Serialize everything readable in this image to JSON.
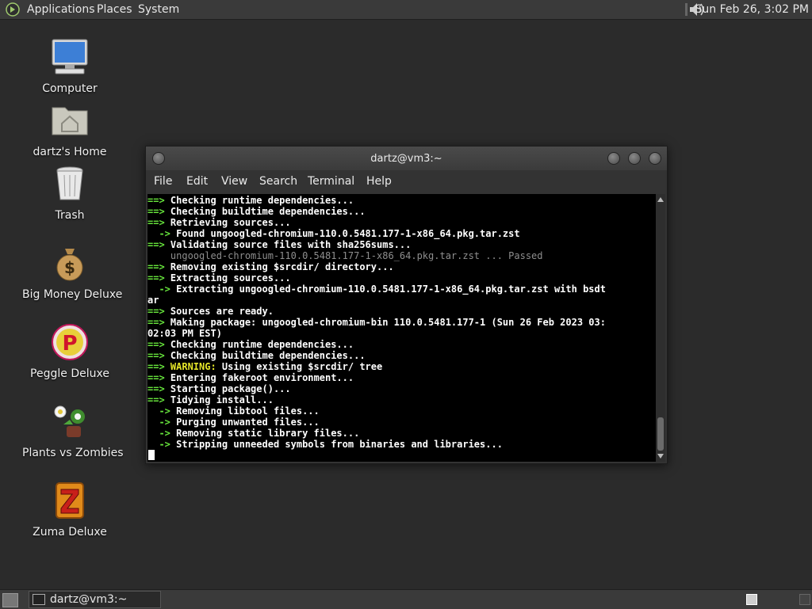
{
  "top_panel": {
    "menus": [
      "Applications",
      "Places",
      "System"
    ],
    "clock": "Sun Feb 26,  3:02 PM"
  },
  "desktop": {
    "icons": [
      {
        "label": "Computer",
        "icon": "computer-icon"
      },
      {
        "label": "dartz's Home",
        "icon": "home-folder-icon"
      },
      {
        "label": "Trash",
        "icon": "trash-icon"
      },
      {
        "label": "Big Money Deluxe",
        "icon": "money-bag-icon"
      },
      {
        "label": "Peggle Deluxe",
        "icon": "peggle-icon"
      },
      {
        "label": "Plants vs Zombies",
        "icon": "plants-vs-zombies-icon"
      },
      {
        "label": "Zuma Deluxe",
        "icon": "zuma-icon"
      }
    ]
  },
  "terminal": {
    "title": "dartz@vm3:~",
    "menu": [
      "File",
      "Edit",
      "View",
      "Search",
      "Terminal",
      "Help"
    ],
    "lines": [
      {
        "prefix": "==> ",
        "text": "Checking runtime dependencies..."
      },
      {
        "prefix": "==> ",
        "text": "Checking buildtime dependencies..."
      },
      {
        "prefix": "==> ",
        "text": "Retrieving sources..."
      },
      {
        "prefix": "  -> ",
        "text": "Found ungoogled-chromium-110.0.5481.177-1-x86_64.pkg.tar.zst"
      },
      {
        "prefix": "==> ",
        "text": "Validating source files with sha256sums..."
      },
      {
        "prefix": "    ",
        "text": "ungoogled-chromium-110.0.5481.177-1-x86_64.pkg.tar.zst ... Passed"
      },
      {
        "prefix": "==> ",
        "text": "Removing existing $srcdir/ directory..."
      },
      {
        "prefix": "==> ",
        "text": "Extracting sources..."
      },
      {
        "prefix": "  -> ",
        "text": "Extracting ungoogled-chromium-110.0.5481.177-1-x86_64.pkg.tar.zst with bsdt"
      },
      {
        "prefix": "",
        "text": "ar"
      },
      {
        "prefix": "==> ",
        "text": "Sources are ready."
      },
      {
        "prefix": "==> ",
        "text": "Making package: ungoogled-chromium-bin 110.0.5481.177-1 (Sun 26 Feb 2023 03:"
      },
      {
        "prefix": "",
        "text": "02:03 PM EST)"
      },
      {
        "prefix": "==> ",
        "text": "Checking runtime dependencies..."
      },
      {
        "prefix": "==> ",
        "text": "Checking buildtime dependencies..."
      },
      {
        "prefix": "==> ",
        "warning": "WARNING:",
        "text": " Using existing $srcdir/ tree"
      },
      {
        "prefix": "==> ",
        "text": "Entering fakeroot environment..."
      },
      {
        "prefix": "==> ",
        "text": "Starting package()..."
      },
      {
        "prefix": "==> ",
        "text": "Tidying install..."
      },
      {
        "prefix": "  -> ",
        "text": "Removing libtool files..."
      },
      {
        "prefix": "  -> ",
        "text": "Purging unwanted files..."
      },
      {
        "prefix": "  -> ",
        "text": "Removing static library files..."
      },
      {
        "prefix": "  -> ",
        "text": "Stripping unneeded symbols from binaries and libraries..."
      }
    ]
  },
  "taskbar": {
    "window_button": "dartz@vm3:~"
  },
  "colors": {
    "desktop": "#2b2b2b",
    "panel": "#3a3a3a",
    "prompt_arrow": "#67e43c",
    "warning": "#e6e629",
    "terminal_bg": "#000000"
  }
}
